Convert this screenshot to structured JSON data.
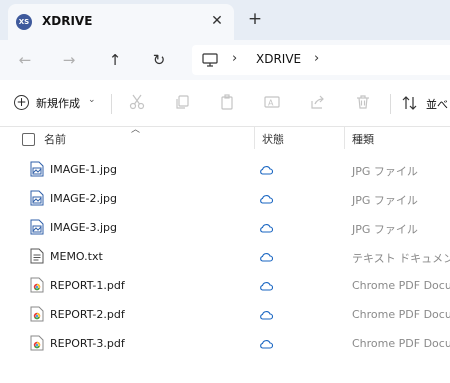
{
  "window": {
    "tab_title": "XDRIVE",
    "tab_icon_text": "XS"
  },
  "address_bar": {
    "location": "XDRIVE"
  },
  "toolbar": {
    "new_label": "新規作成",
    "sort_label": "並べ"
  },
  "columns": {
    "name": "名前",
    "status": "状態",
    "type": "種類"
  },
  "files": [
    {
      "name": "IMAGE-1.jpg",
      "type": "JPG ファイル",
      "icon": "image-file-icon",
      "status": "cloud-icon"
    },
    {
      "name": "IMAGE-2.jpg",
      "type": "JPG ファイル",
      "icon": "image-file-icon",
      "status": "cloud-icon"
    },
    {
      "name": "IMAGE-3.jpg",
      "type": "JPG ファイル",
      "icon": "image-file-icon",
      "status": "cloud-icon"
    },
    {
      "name": "MEMO.txt",
      "type": "テキスト ドキュメント",
      "icon": "text-file-icon",
      "status": "cloud-icon"
    },
    {
      "name": "REPORT-1.pdf",
      "type": "Chrome PDF Docu...",
      "icon": "pdf-file-icon",
      "status": "cloud-icon"
    },
    {
      "name": "REPORT-2.pdf",
      "type": "Chrome PDF Docu...",
      "icon": "pdf-file-icon",
      "status": "cloud-icon"
    },
    {
      "name": "REPORT-3.pdf",
      "type": "Chrome PDF Docu...",
      "icon": "pdf-file-icon",
      "status": "cloud-icon"
    }
  ],
  "colors": {
    "tabbar_bg": "#e7edf5",
    "nav_bg": "#f6f8fb",
    "cloud_status": "#1a66c2",
    "icon_blue": "#2f5fa8"
  }
}
